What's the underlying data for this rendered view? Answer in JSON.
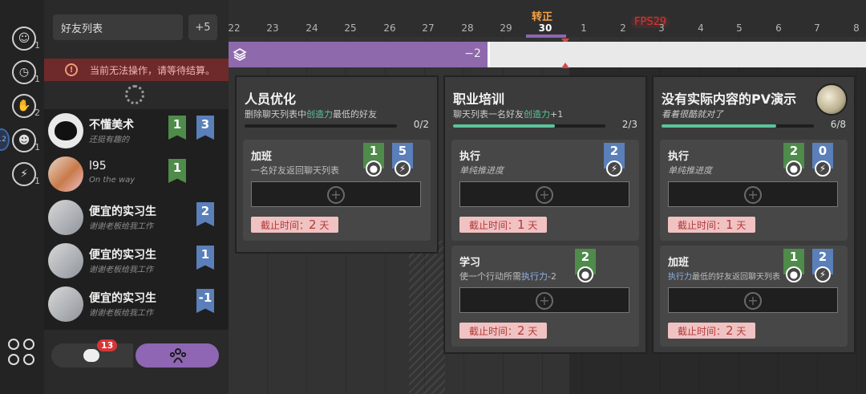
{
  "rail": {
    "items": [
      {
        "icon": "manager-icon",
        "count": "1"
      },
      {
        "icon": "clock-icon",
        "count": "1"
      },
      {
        "icon": "handshake-icon",
        "count": "2"
      },
      {
        "icon": "person-icon",
        "count": "1"
      },
      {
        "icon": "lightning-icon",
        "count": "1"
      }
    ],
    "tab_number": "12"
  },
  "friends": {
    "title": "好友列表",
    "plus": "+5",
    "warning": "当前无法操作，请等待结算。",
    "list": [
      {
        "name": "不懂美术",
        "subtitle": "还挺有趣的",
        "green": "1",
        "blue": "3"
      },
      {
        "name": "l95",
        "subtitle": "On the way",
        "green": "1",
        "blue": ""
      },
      {
        "name": "便宜的实习生",
        "subtitle": "谢谢老板给我工作",
        "green": "",
        "blue": "2"
      },
      {
        "name": "便宜的实习生",
        "subtitle": "谢谢老板给我工作",
        "green": "",
        "blue": "1"
      },
      {
        "name": "便宜的实习生",
        "subtitle": "谢谢老板给我工作",
        "green": "",
        "blue": "-1"
      }
    ],
    "chat_badge": "13"
  },
  "timeline": {
    "turn_label": "转正",
    "fps": "FPS29",
    "ticks": [
      "22",
      "23",
      "24",
      "25",
      "26",
      "27",
      "28",
      "29",
      "30",
      "1",
      "2",
      "3",
      "4",
      "5",
      "6",
      "7",
      "8"
    ],
    "current": "30",
    "track_value": "−2",
    "track_fill_fraction": 0.41
  },
  "cards": [
    {
      "title": "人员优化",
      "desc_pre": "删除聊天列表中",
      "desc_hl": "创造力",
      "desc_post": "最低的好友",
      "progress_text": "0/2",
      "progress_fraction": 0.0,
      "tasks": [
        {
          "title": "加班",
          "desc": "一名好友返回聊天列表",
          "green": "1",
          "blue": "5",
          "deadline_label": "截止时间：",
          "deadline_value": "2",
          "deadline_unit": "天"
        }
      ]
    },
    {
      "title": "职业培训",
      "desc_pre": "聊天列表一名好友",
      "desc_hl": "创造力",
      "desc_post": "+1",
      "progress_text": "2/3",
      "progress_fraction": 0.67,
      "tasks": [
        {
          "title": "执行",
          "desc": "单纯推进度",
          "green": "",
          "blue": "2",
          "deadline_label": "截止时间：",
          "deadline_value": "1",
          "deadline_unit": "天"
        },
        {
          "title": "学习",
          "desc_pre": "使一个行动所需",
          "desc_hl": "执行力",
          "desc_post": "-2",
          "green": "2",
          "blue": "",
          "deadline_label": "截止时间：",
          "deadline_value": "2",
          "deadline_unit": "天"
        }
      ]
    },
    {
      "title": "没有实际内容的PV演示",
      "desc": "看着很酷就对了",
      "progress_text": "6/8",
      "progress_fraction": 0.75,
      "tasks": [
        {
          "title": "执行",
          "desc": "单纯推进度",
          "green": "2",
          "blue": "0",
          "deadline_label": "截止时间：",
          "deadline_value": "1",
          "deadline_unit": "天"
        },
        {
          "title": "加班",
          "desc_hl": "执行力",
          "desc_post": "最低的好友返回聊天列表",
          "green": "1",
          "blue": "2",
          "deadline_label": "截止时间：",
          "deadline_value": "2",
          "deadline_unit": "天"
        }
      ]
    }
  ],
  "colors": {
    "accent": "#8e66b3",
    "creativity": "#5cc39a",
    "execution": "#8fb0e6",
    "warning": "#6e2a2a",
    "deadline": "#f0c2c2"
  }
}
